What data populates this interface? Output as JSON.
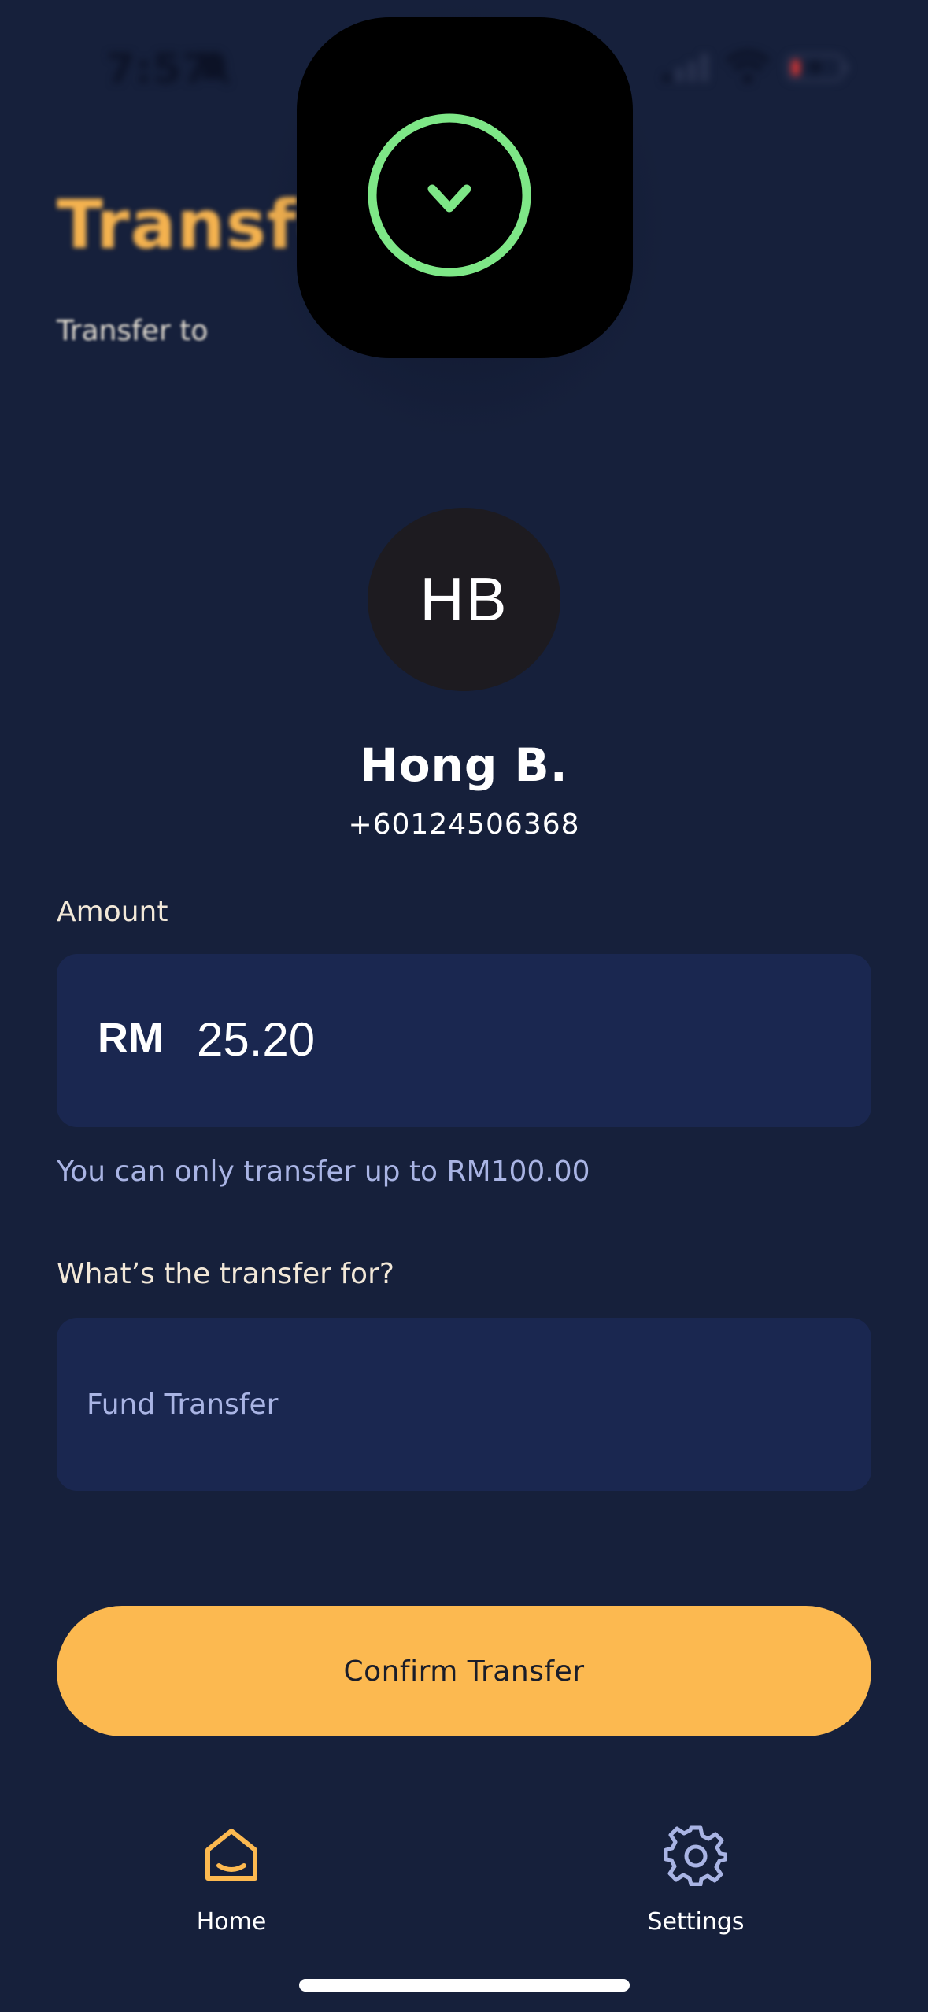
{
  "status_bar": {
    "time": "7:57"
  },
  "header": {
    "title": "Transfer",
    "subtitle": "Transfer to"
  },
  "recipient": {
    "initials": "HB",
    "name": "Hong B.",
    "phone": "+60124506368"
  },
  "amount": {
    "label": "Amount",
    "currency": "RM",
    "value": "25.20",
    "hint": "You can only transfer up to RM100.00"
  },
  "purpose": {
    "label": "What’s the transfer for?",
    "placeholder": "Fund Transfer"
  },
  "confirm": {
    "label": "Confirm Transfer"
  },
  "nav": {
    "items": [
      {
        "label": "Home",
        "icon": "home-icon",
        "active": true
      },
      {
        "label": "Settings",
        "icon": "gear-icon",
        "active": false
      }
    ]
  },
  "overlay": {
    "icon": "download-circle-icon"
  },
  "colors": {
    "background": "#16203b",
    "accent": "#fcb950",
    "field": "#1a2750",
    "hint": "#a9b4e4",
    "overlay_green": "#7ee787"
  }
}
